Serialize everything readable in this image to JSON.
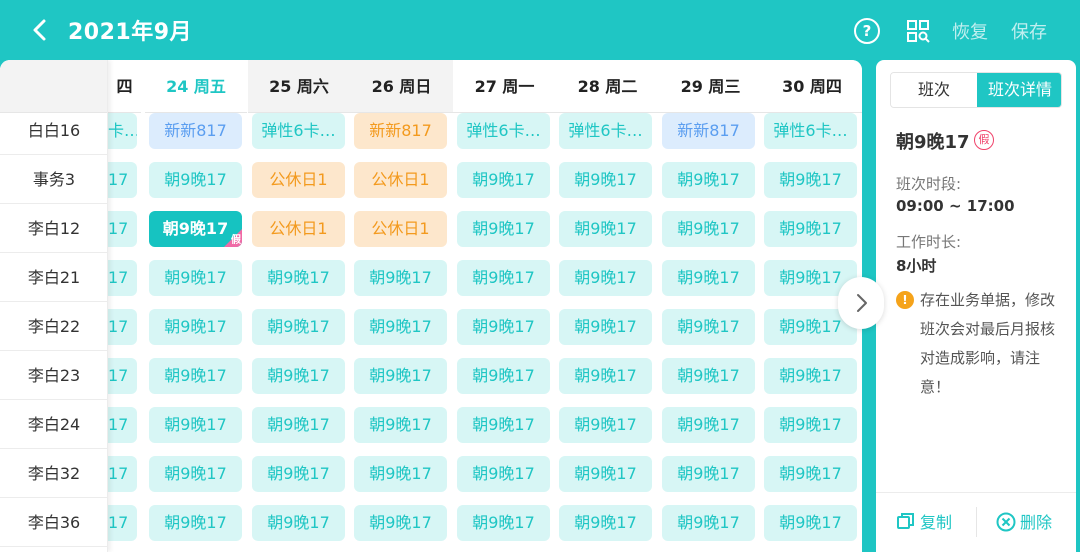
{
  "header": {
    "title": "2021年9月",
    "help_label": "?",
    "restore_label": "恢复",
    "save_label": "保存"
  },
  "days": [
    {
      "label": "四",
      "variant": "weekday"
    },
    {
      "label": "24 周五",
      "variant": "hl"
    },
    {
      "label": "25 周六",
      "variant": "weekend"
    },
    {
      "label": "26 周日",
      "variant": "weekend"
    },
    {
      "label": "27 周一",
      "variant": "weekday"
    },
    {
      "label": "28 周二",
      "variant": "weekday"
    },
    {
      "label": "29 周三",
      "variant": "weekday"
    },
    {
      "label": "30 周四",
      "variant": "weekday"
    }
  ],
  "rows": [
    {
      "name": "白白16",
      "cells": [
        {
          "t": "卡…",
          "c": "teal"
        },
        {
          "t": "新新817",
          "c": "blue"
        },
        {
          "t": "弹性6卡…",
          "c": "teal"
        },
        {
          "t": "新新817",
          "c": "orange"
        },
        {
          "t": "弹性6卡…",
          "c": "teal"
        },
        {
          "t": "弹性6卡…",
          "c": "teal"
        },
        {
          "t": "新新817",
          "c": "blue"
        },
        {
          "t": "弹性6卡…",
          "c": "teal"
        }
      ]
    },
    {
      "name": "事务3",
      "cells": [
        {
          "t": "17",
          "c": "teal"
        },
        {
          "t": "朝9晚17",
          "c": "teal"
        },
        {
          "t": "公休日1",
          "c": "orange"
        },
        {
          "t": "公休日1",
          "c": "orange"
        },
        {
          "t": "朝9晚17",
          "c": "teal"
        },
        {
          "t": "朝9晚17",
          "c": "teal"
        },
        {
          "t": "朝9晚17",
          "c": "teal"
        },
        {
          "t": "朝9晚17",
          "c": "teal"
        }
      ]
    },
    {
      "name": "李白12",
      "cells": [
        {
          "t": "17",
          "c": "teal"
        },
        {
          "t": "朝9晚17",
          "c": "sel",
          "corner": "假"
        },
        {
          "t": "公休日1",
          "c": "orange"
        },
        {
          "t": "公休日1",
          "c": "orange"
        },
        {
          "t": "朝9晚17",
          "c": "teal"
        },
        {
          "t": "朝9晚17",
          "c": "teal"
        },
        {
          "t": "朝9晚17",
          "c": "teal"
        },
        {
          "t": "朝9晚17",
          "c": "teal"
        }
      ]
    },
    {
      "name": "李白21",
      "cells": [
        {
          "t": "17",
          "c": "teal"
        },
        {
          "t": "朝9晚17",
          "c": "teal"
        },
        {
          "t": "朝9晚17",
          "c": "teal"
        },
        {
          "t": "朝9晚17",
          "c": "teal"
        },
        {
          "t": "朝9晚17",
          "c": "teal"
        },
        {
          "t": "朝9晚17",
          "c": "teal"
        },
        {
          "t": "朝9晚17",
          "c": "teal"
        },
        {
          "t": "朝9晚17",
          "c": "teal"
        }
      ]
    },
    {
      "name": "李白22",
      "cells": [
        {
          "t": "17",
          "c": "teal"
        },
        {
          "t": "朝9晚17",
          "c": "teal"
        },
        {
          "t": "朝9晚17",
          "c": "teal"
        },
        {
          "t": "朝9晚17",
          "c": "teal"
        },
        {
          "t": "朝9晚17",
          "c": "teal"
        },
        {
          "t": "朝9晚17",
          "c": "teal"
        },
        {
          "t": "朝9晚17",
          "c": "teal"
        },
        {
          "t": "朝9晚17",
          "c": "teal"
        }
      ]
    },
    {
      "name": "李白23",
      "cells": [
        {
          "t": "17",
          "c": "teal"
        },
        {
          "t": "朝9晚17",
          "c": "teal"
        },
        {
          "t": "朝9晚17",
          "c": "teal"
        },
        {
          "t": "朝9晚17",
          "c": "teal"
        },
        {
          "t": "朝9晚17",
          "c": "teal"
        },
        {
          "t": "朝9晚17",
          "c": "teal"
        },
        {
          "t": "朝9晚17",
          "c": "teal"
        },
        {
          "t": "朝9晚17",
          "c": "teal"
        }
      ]
    },
    {
      "name": "李白24",
      "cells": [
        {
          "t": "17",
          "c": "teal"
        },
        {
          "t": "朝9晚17",
          "c": "teal"
        },
        {
          "t": "朝9晚17",
          "c": "teal"
        },
        {
          "t": "朝9晚17",
          "c": "teal"
        },
        {
          "t": "朝9晚17",
          "c": "teal"
        },
        {
          "t": "朝9晚17",
          "c": "teal"
        },
        {
          "t": "朝9晚17",
          "c": "teal"
        },
        {
          "t": "朝9晚17",
          "c": "teal"
        }
      ]
    },
    {
      "name": "李白32",
      "cells": [
        {
          "t": "17",
          "c": "teal"
        },
        {
          "t": "朝9晚17",
          "c": "teal"
        },
        {
          "t": "朝9晚17",
          "c": "teal"
        },
        {
          "t": "朝9晚17",
          "c": "teal"
        },
        {
          "t": "朝9晚17",
          "c": "teal"
        },
        {
          "t": "朝9晚17",
          "c": "teal"
        },
        {
          "t": "朝9晚17",
          "c": "teal"
        },
        {
          "t": "朝9晚17",
          "c": "teal"
        }
      ]
    },
    {
      "name": "李白36",
      "cells": [
        {
          "t": "17",
          "c": "teal"
        },
        {
          "t": "朝9晚17",
          "c": "teal"
        },
        {
          "t": "朝9晚17",
          "c": "teal"
        },
        {
          "t": "朝9晚17",
          "c": "teal"
        },
        {
          "t": "朝9晚17",
          "c": "teal"
        },
        {
          "t": "朝9晚17",
          "c": "teal"
        },
        {
          "t": "朝9晚17",
          "c": "teal"
        },
        {
          "t": "朝9晚17",
          "c": "teal"
        }
      ]
    }
  ],
  "panel": {
    "tabs": [
      "班次",
      "班次详情"
    ],
    "active_tab": 1,
    "shift_name": "朝9晚17",
    "badge": "假",
    "period_label": "班次时段:",
    "period_value": "09:00 ~ 17:00",
    "duration_label": "工作时长:",
    "duration_value": "8小时",
    "warning": "存在业务单据，修改班次会对最后月报核对造成影响，请注意！",
    "copy_label": "复制",
    "delete_label": "删除"
  },
  "colors": {
    "accent": "#1fc6c4",
    "teal_bg": "#d7f6f5",
    "blue_bg": "#dcecfd",
    "orange_bg": "#fde7cc",
    "warning": "#f5a31a",
    "holiday_badge": "#f06aa6"
  },
  "icons": [
    "back-arrow-icon",
    "help-icon",
    "qr-code-icon",
    "chevron-right-icon",
    "warning-icon",
    "copy-icon",
    "delete-icon"
  ]
}
